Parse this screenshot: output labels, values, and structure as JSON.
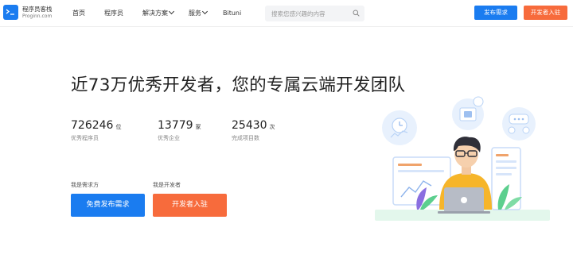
{
  "header": {
    "logo_cn": "程序员客栈",
    "logo_en": "Proginn.com",
    "nav": [
      "首页",
      "程序员",
      "解决方案",
      "服务",
      "Bituni"
    ],
    "search_placeholder": "搜索您感兴趣的内容",
    "publish_btn": "发布需求",
    "join_btn": "开发者入驻"
  },
  "hero": {
    "title": "近73万优秀开发者，您的专属云端开发团队",
    "stats": [
      {
        "value": "726246",
        "unit": "位",
        "label": "优秀程序员"
      },
      {
        "value": "13779",
        "unit": "家",
        "label": "优秀企业"
      },
      {
        "value": "25430",
        "unit": "次",
        "label": "完成项目数"
      }
    ],
    "roles": [
      {
        "label": "我是需求方",
        "button": "免费发布需求"
      },
      {
        "label": "我是开发者",
        "button": "开发者入驻"
      }
    ]
  },
  "colors": {
    "primary": "#1a7cf0",
    "accent": "#f76b3c"
  }
}
